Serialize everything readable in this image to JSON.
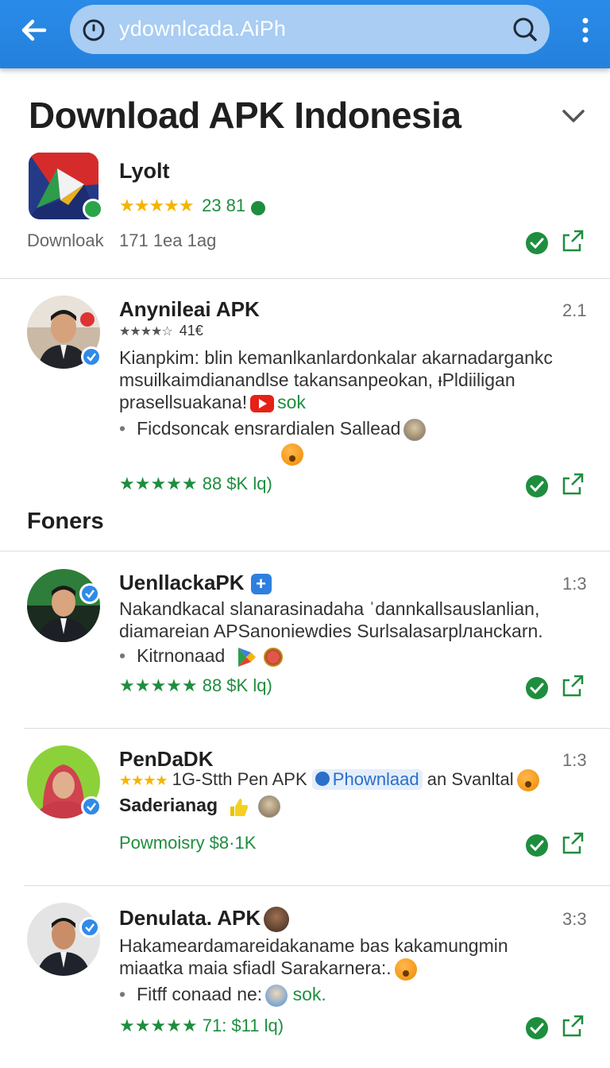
{
  "browser": {
    "url": "ydownlcada.AiPh",
    "icons": [
      "back-arrow-icon",
      "site-info-icon",
      "search-icon",
      "more-vert-icon"
    ]
  },
  "page": {
    "title": "Download APK Indonesia",
    "section_heading": "Foners"
  },
  "featured": {
    "name": "Lyolt",
    "rating": "★★★★★ 23 81",
    "download_label": "Downloak",
    "meta": "171 1ea 1ag"
  },
  "posts": [
    {
      "name": "Anynileai APK",
      "time": "2.1",
      "small_rating": "★★★★☆",
      "small_rating_value": "41€",
      "desc_line1": "Kianpkim: blin kemanlkanlardonkalar akarnadargankc",
      "desc_line2": "msuilkaimdianandlse takansanpeokan, ᵻPldiiligan",
      "desc_line3_text": "prasellsuakana!",
      "desc_line3_link": "sok",
      "bullet": "Ficdsoncak ensrardialen Sallead",
      "footer": "★★★★★ 88 $K lq)"
    },
    {
      "name": "UenllackaPK",
      "time": "1:3",
      "plus": "+",
      "desc_line1": "Nakandkacal slanarasinadaha ˈdannkallsauslanlian,",
      "desc_line2": "diamareian APSanoniewdies Surlsalasarplланckarn.",
      "bullet": "Kitrnonaad",
      "footer": "★★★★★ 88 $K lq)"
    },
    {
      "name": "PenDaDK",
      "time": "1:3",
      "line2_stars": "★★★★",
      "line2_text": "1G-Stth Pen APK",
      "line2_chip": "Phownlaad",
      "line2_tail": "an Svanltal",
      "line3": "Saderianag",
      "footer": "Powmoisry $8·1K"
    },
    {
      "name": "Denulata. APK",
      "time": "3:3",
      "desc_line1": "Hakameardamareidakaname bas kakamungmin",
      "desc_line2": "miaatka maia sfiadl Sarakarnera:.",
      "bullet_text": "Fitff conaad ne:",
      "bullet_link": "sok.",
      "footer": "★★★★★ 71: $11 lq)"
    }
  ],
  "colors": {
    "topbar": "#2481dd",
    "star": "#f5b400",
    "green": "#1e8e3e",
    "verify_blue": "#2f8ae8"
  }
}
